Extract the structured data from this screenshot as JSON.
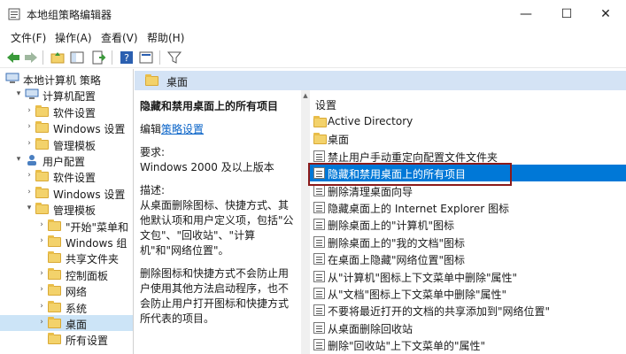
{
  "window": {
    "title": "本地组策略编辑器",
    "min": "—",
    "max": "☐",
    "close": "✕"
  },
  "menu": [
    "文件(F)",
    "操作(A)",
    "查看(V)",
    "帮助(H)"
  ],
  "tree": [
    {
      "label": "本地计算机 策略",
      "level": 0,
      "arrow": "",
      "icon": "computer"
    },
    {
      "label": "计算机配置",
      "level": 1,
      "arrow": "▾",
      "icon": "computer"
    },
    {
      "label": "软件设置",
      "level": 2,
      "arrow": "›",
      "icon": "folder"
    },
    {
      "label": "Windows 设置",
      "level": 2,
      "arrow": "›",
      "icon": "folder"
    },
    {
      "label": "管理模板",
      "level": 2,
      "arrow": "›",
      "icon": "folder"
    },
    {
      "label": "用户配置",
      "level": 1,
      "arrow": "▾",
      "icon": "user"
    },
    {
      "label": "软件设置",
      "level": 2,
      "arrow": "›",
      "icon": "folder"
    },
    {
      "label": "Windows 设置",
      "level": 2,
      "arrow": "›",
      "icon": "folder"
    },
    {
      "label": "管理模板",
      "level": 2,
      "arrow": "▾",
      "icon": "folder"
    },
    {
      "label": "\"开始\"菜单和",
      "level": 3,
      "arrow": "›",
      "icon": "folder"
    },
    {
      "label": "Windows 组",
      "level": 3,
      "arrow": "›",
      "icon": "folder"
    },
    {
      "label": "共享文件夹",
      "level": 3,
      "arrow": "",
      "icon": "folder"
    },
    {
      "label": "控制面板",
      "level": 3,
      "arrow": "›",
      "icon": "folder"
    },
    {
      "label": "网络",
      "level": 3,
      "arrow": "›",
      "icon": "folder"
    },
    {
      "label": "系统",
      "level": 3,
      "arrow": "›",
      "icon": "folder"
    },
    {
      "label": "桌面",
      "level": 3,
      "arrow": "›",
      "icon": "folder",
      "selected": true
    },
    {
      "label": "所有设置",
      "level": 3,
      "arrow": "",
      "icon": "folder"
    }
  ],
  "right_header": "桌面",
  "desc": {
    "title": "隐藏和禁用桌面上的所有项目",
    "edit_prefix": "编辑",
    "edit_link": "策略设置",
    "req_label": "要求:",
    "req_value": "Windows 2000 及以上版本",
    "desc_label": "描述:",
    "desc_text": "从桌面删除图标、快捷方式、其他默认项和用户定义项，包括\"公文包\"、\"回收站\"、\"计算机\"和\"网络位置\"。",
    "desc_text2": "删除图标和快捷方式不会防止用户使用其他方法启动程序，也不会防止用户打开图标和快捷方式所代表的项目。"
  },
  "list": {
    "header": "设置",
    "items": [
      {
        "label": "Active Directory",
        "icon": "folder"
      },
      {
        "label": "桌面",
        "icon": "folder"
      },
      {
        "label": "禁止用户手动重定向配置文件文件夹",
        "icon": "policy"
      },
      {
        "label": "隐藏和禁用桌面上的所有项目",
        "icon": "policy",
        "selected": true
      },
      {
        "label": "删除清理桌面向导",
        "icon": "policy"
      },
      {
        "label": "隐藏桌面上的 Internet Explorer 图标",
        "icon": "policy"
      },
      {
        "label": "删除桌面上的\"计算机\"图标",
        "icon": "policy"
      },
      {
        "label": "删除桌面上的\"我的文档\"图标",
        "icon": "policy"
      },
      {
        "label": "在桌面上隐藏\"网络位置\"图标",
        "icon": "policy"
      },
      {
        "label": "从\"计算机\"图标上下文菜单中删除\"属性\"",
        "icon": "policy"
      },
      {
        "label": "从\"文档\"图标上下文菜单中删除\"属性\"",
        "icon": "policy"
      },
      {
        "label": "不要将最近打开的文档的共享添加到\"网络位置\"",
        "icon": "policy"
      },
      {
        "label": "从桌面删除回收站",
        "icon": "policy"
      },
      {
        "label": "删除\"回收站\"上下文菜单的\"属性\"",
        "icon": "policy"
      }
    ]
  }
}
